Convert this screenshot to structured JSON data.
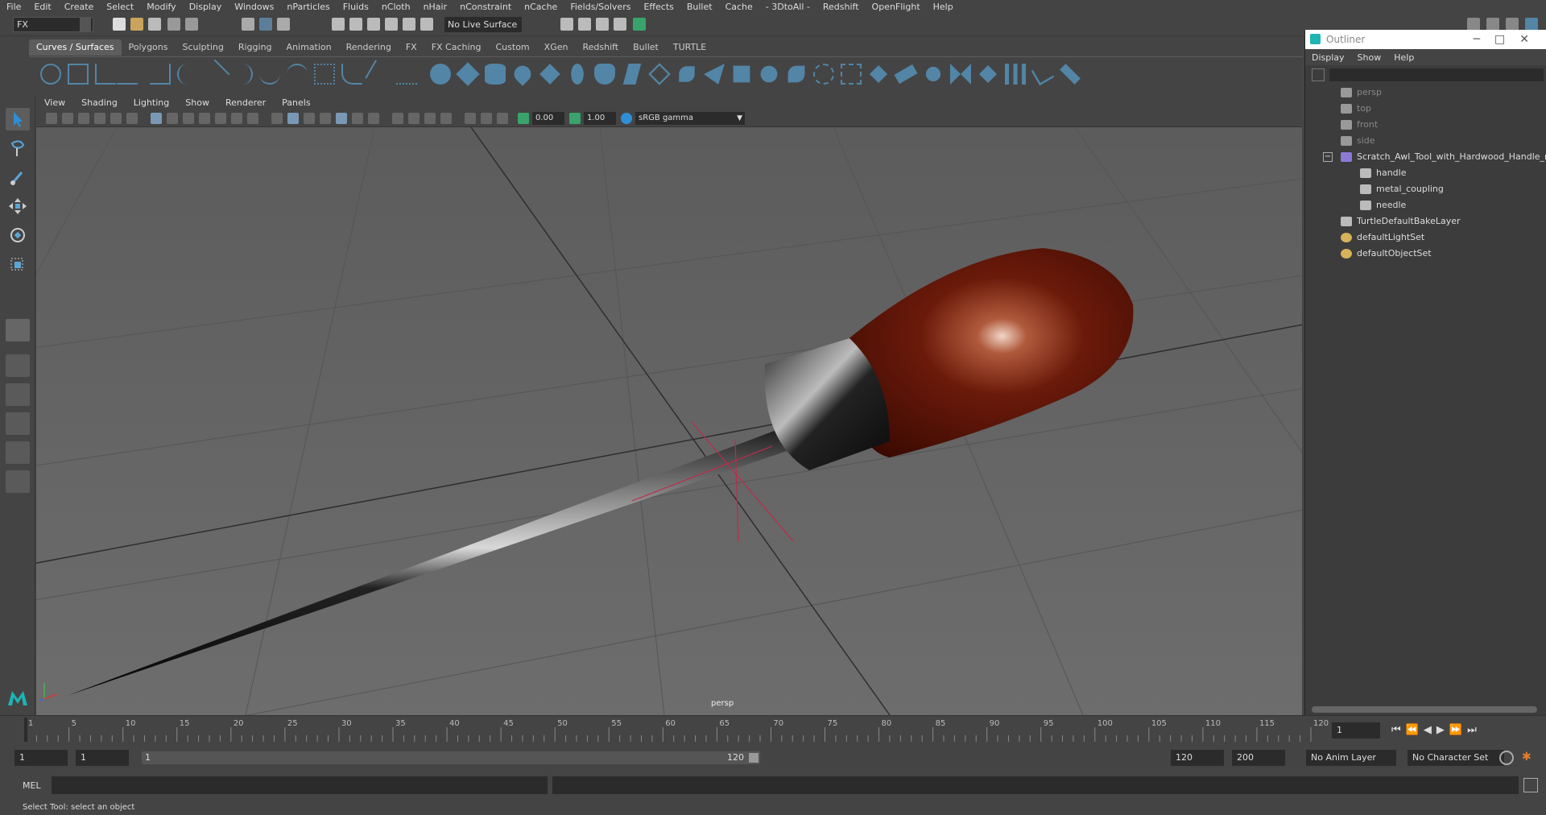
{
  "menubar": [
    "File",
    "Edit",
    "Create",
    "Select",
    "Modify",
    "Display",
    "Windows",
    "nParticles",
    "Fluids",
    "nCloth",
    "nHair",
    "nConstraint",
    "nCache",
    "Fields/Solvers",
    "Effects",
    "Bullet",
    "Cache",
    "- 3DtoAll -",
    "Redshift",
    "OpenFlight",
    "Help"
  ],
  "status": {
    "mode": "FX",
    "live_surface": "No Live Surface"
  },
  "shelf_tabs": [
    "Curves / Surfaces",
    "Polygons",
    "Sculpting",
    "Rigging",
    "Animation",
    "Rendering",
    "FX",
    "FX Caching",
    "Custom",
    "XGen",
    "Redshift",
    "Bullet",
    "TURTLE"
  ],
  "panel_menu": [
    "View",
    "Shading",
    "Lighting",
    "Show",
    "Renderer",
    "Panels"
  ],
  "panel_toolbar": {
    "exposure": "0.00",
    "gamma": "1.00",
    "color_space": "sRGB gamma"
  },
  "viewport": {
    "camera_label": "persp"
  },
  "outliner": {
    "title": "Outliner",
    "menu": [
      "Display",
      "Show",
      "Help"
    ],
    "items": [
      {
        "label": "persp",
        "icon": "camera-icon",
        "dim": true,
        "indent": 0
      },
      {
        "label": "top",
        "icon": "camera-icon",
        "dim": true,
        "indent": 0
      },
      {
        "label": "front",
        "icon": "camera-icon",
        "dim": true,
        "indent": 0
      },
      {
        "label": "side",
        "icon": "camera-icon",
        "dim": true,
        "indent": 0
      },
      {
        "label": "Scratch_Awl_Tool_with_Hardwood_Handle_n",
        "icon": "group-icon",
        "dim": false,
        "indent": 0
      },
      {
        "label": "handle",
        "icon": "mesh-icon",
        "dim": false,
        "indent": 1
      },
      {
        "label": "metal_coupling",
        "icon": "mesh-icon",
        "dim": false,
        "indent": 1
      },
      {
        "label": "needle",
        "icon": "mesh-icon",
        "dim": false,
        "indent": 1
      },
      {
        "label": "TurtleDefaultBakeLayer",
        "icon": "layer-icon",
        "dim": false,
        "indent": 0
      },
      {
        "label": "defaultLightSet",
        "icon": "set-icon",
        "dim": false,
        "indent": 0
      },
      {
        "label": "defaultObjectSet",
        "icon": "set-icon",
        "dim": false,
        "indent": 0
      }
    ]
  },
  "timeline": {
    "ticks": [
      "1",
      "5",
      "10",
      "15",
      "20",
      "25",
      "30",
      "35",
      "40",
      "45",
      "50",
      "55",
      "60",
      "65",
      "70",
      "75",
      "80",
      "85",
      "90",
      "95",
      "100",
      "105",
      "110",
      "115",
      "120"
    ],
    "current_frame": "1"
  },
  "range": {
    "start": "1",
    "anim_start": "1",
    "slider_start": "1",
    "slider_end": "120",
    "end": "120",
    "anim_end": "200",
    "anim_layer": "No Anim Layer",
    "character_set": "No Character Set"
  },
  "command_line": {
    "label": "MEL"
  },
  "help_line": "Select Tool: select an object",
  "colors": {
    "accent": "#5285a6",
    "handle": "#6b1a0a",
    "selection": "#bf2a4a"
  }
}
